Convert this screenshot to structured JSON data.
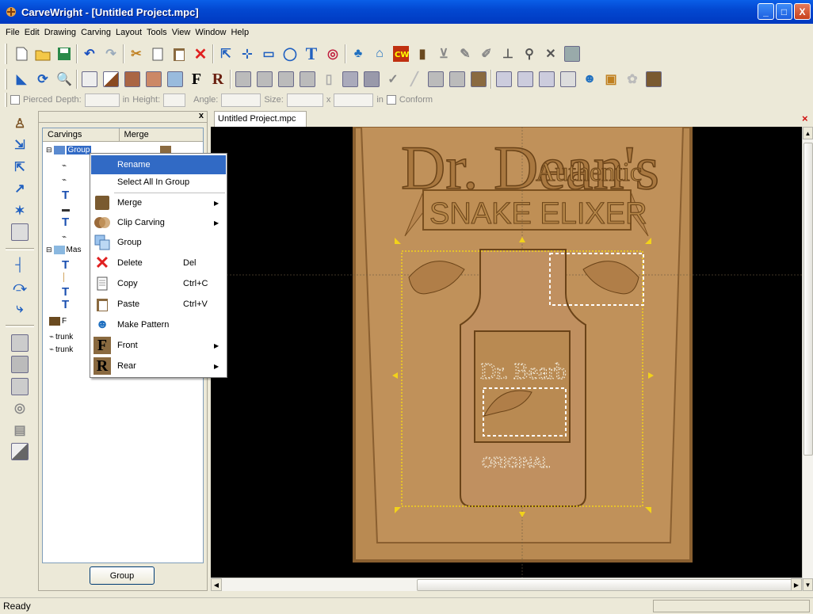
{
  "window": {
    "title": "CarveWright - [Untitled Project.mpc]",
    "minimize": "_",
    "maximize": "□",
    "close": "X"
  },
  "menu": [
    "File",
    "Edit",
    "Drawing",
    "Carving",
    "Layout",
    "Tools",
    "View",
    "Window",
    "Help"
  ],
  "props": {
    "pierced": "Pierced",
    "depth": "Depth:",
    "in1": "in",
    "height": "Height:",
    "angle": "Angle:",
    "size": "Size:",
    "x": "x",
    "in2": "in",
    "conform": "Conform"
  },
  "panel": {
    "col_carvings": "Carvings",
    "col_merge": "Merge",
    "close": "x",
    "group_button": "Group",
    "tree": {
      "group_label": "Group",
      "mask_label": "Mas",
      "f_label": "F",
      "trunk1": "trunk",
      "trunk2": "trunk"
    }
  },
  "doc_tab": "Untitled Project.mpc",
  "doc_close": "×",
  "carving_text": {
    "top": "Dr. Dean's",
    "authentic": "Authentic",
    "banner": "SNAKE ELIXER",
    "label_name": "Dr. Bearb",
    "label_bottom": "ORIGINAL"
  },
  "context_menu": [
    {
      "label": "Rename",
      "shortcut": "",
      "submenu": false,
      "icon": "",
      "highlighted": true
    },
    {
      "label": "Select All In Group",
      "shortcut": "",
      "submenu": false,
      "icon": "",
      "highlighted": false
    },
    {
      "label": "Merge",
      "shortcut": "",
      "submenu": true,
      "icon": "merge-icon",
      "highlighted": false
    },
    {
      "label": "Clip Carving",
      "shortcut": "",
      "submenu": true,
      "icon": "clip-icon",
      "highlighted": false
    },
    {
      "label": "Group",
      "shortcut": "",
      "submenu": false,
      "icon": "group-icon",
      "highlighted": false
    },
    {
      "label": "Delete",
      "shortcut": "Del",
      "submenu": false,
      "icon": "delete-icon",
      "highlighted": false
    },
    {
      "label": "Copy",
      "shortcut": "Ctrl+C",
      "submenu": false,
      "icon": "copy-icon",
      "highlighted": false
    },
    {
      "label": "Paste",
      "shortcut": "Ctrl+V",
      "submenu": false,
      "icon": "paste-icon",
      "highlighted": false
    },
    {
      "label": "Make Pattern",
      "shortcut": "",
      "submenu": false,
      "icon": "pattern-icon",
      "highlighted": false
    },
    {
      "label": "Front",
      "shortcut": "",
      "submenu": true,
      "icon": "front-icon",
      "highlighted": false
    },
    {
      "label": "Rear",
      "shortcut": "",
      "submenu": true,
      "icon": "rear-icon",
      "highlighted": false
    }
  ],
  "status": "Ready",
  "colors": {
    "title_bar": "#0348d1",
    "highlight": "#316ac5",
    "wood": "#b98a52",
    "selection": "#f2d21a"
  }
}
